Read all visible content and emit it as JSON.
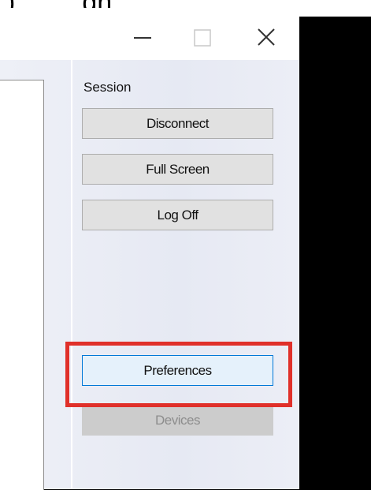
{
  "window": {
    "controls": {
      "minimize_icon": "minimize-icon",
      "maximize_icon": "maximize-icon",
      "close_icon": "close-icon"
    }
  },
  "top_strip": {
    "partial_text": "), ...  ...gh ... ...  ..., ..."
  },
  "session_panel": {
    "heading": "Session",
    "buttons": {
      "disconnect": "Disconnect",
      "full_screen": "Full Screen",
      "log_off": "Log Off",
      "preferences": "Preferences",
      "devices": "Devices"
    },
    "devices_enabled": false
  },
  "colors": {
    "highlight": "#e0302a",
    "focus_border": "#0078d7",
    "focus_fill": "#e5f1fb",
    "button_fill": "#e1e1e1",
    "disabled_text": "#8d8d8d"
  }
}
